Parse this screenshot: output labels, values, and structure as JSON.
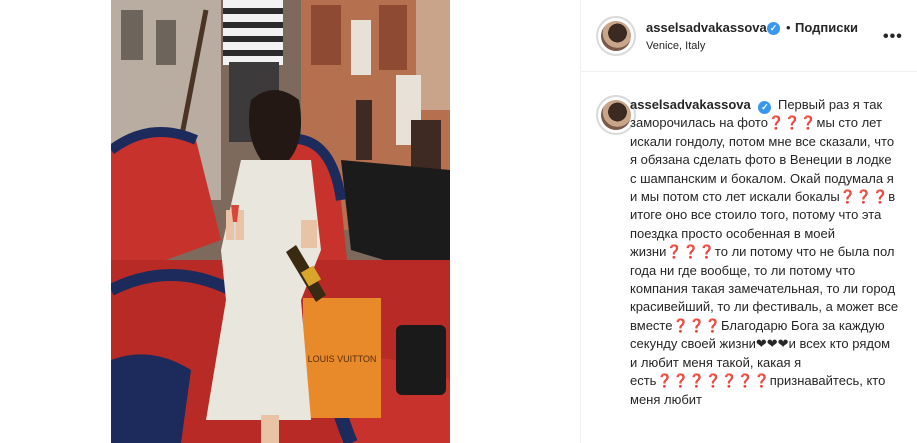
{
  "post": {
    "username": "asselsadvakassova",
    "follow_label": "Подписки",
    "separator": "•",
    "location": "Venice, Italy",
    "more_label": "•••",
    "verified_mark": "✓"
  },
  "caption": {
    "username": "asselsadvakassova",
    "text": "Первый раз я так заморочилась на фото❓❓❓мы сто лет искали гондолу, потом мне все сказали, что я обязана сделать фото в Венеции в лодке с шампанским и бокалом. Окай подумала я и мы потом сто лет искали бокалы❓❓❓в итоге оно все стоило того, потому что эта поездка просто особенная в моей жизни❓❓❓то ли потому что не была пол года ни где вообще, то ли потому что компания такая замечательная, то ли город красивейший, то ли фестиваль, а может все вместе❓❓❓Благодарю Бога за каждую секунду своей жизни❤❤❤и всех кто рядом и любит меня такой, какая я есть❓❓❓❓❓❓❓признавайтесь, кто меня любит"
  },
  "photo": {
    "bag_text": "LOUIS VUITTON",
    "colors": {
      "gondola_red": "#c8322c",
      "fur_navy": "#1d2a5c",
      "dress": "#e9e6de",
      "bag_orange": "#e8892a",
      "building": "#b5704f"
    }
  },
  "colors": {
    "accent": "#3897f0",
    "text": "#262626",
    "divider": "#efefef"
  }
}
